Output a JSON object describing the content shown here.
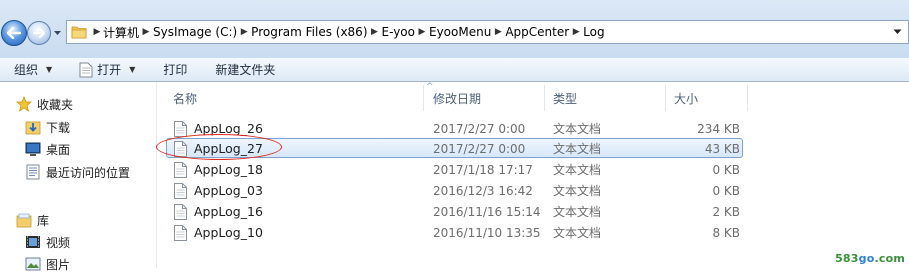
{
  "address_bar": {
    "breadcrumbs": [
      "计算机",
      "SysImage (C:)",
      "Program Files (x86)",
      "E-yoo",
      "EyooMenu",
      "AppCenter",
      "Log"
    ]
  },
  "toolbar": {
    "organize": "组织",
    "open": "打开",
    "print": "打印",
    "new_folder": "新建文件夹"
  },
  "navigation": {
    "favorites": {
      "label": "收藏夹",
      "items": [
        "下载",
        "桌面",
        "最近访问的位置"
      ]
    },
    "library": {
      "label": "库",
      "items": [
        "视频",
        "图片"
      ]
    }
  },
  "file_list": {
    "columns": {
      "name": "名称",
      "date_modified": "修改日期",
      "type": "类型",
      "size": "大小"
    },
    "files": [
      {
        "name": "AppLog_26",
        "date": "2017/2/27 0:00",
        "type": "文本文档",
        "size": "234 KB"
      },
      {
        "name": "AppLog_27",
        "date": "2017/2/27 0:00",
        "type": "文本文档",
        "size": "43 KB"
      },
      {
        "name": "AppLog_18",
        "date": "2017/1/18 17:17",
        "type": "文本文档",
        "size": "0 KB"
      },
      {
        "name": "AppLog_03",
        "date": "2016/12/3 16:42",
        "type": "文本文档",
        "size": "0 KB"
      },
      {
        "name": "AppLog_16",
        "date": "2016/11/16 15:14",
        "type": "文本文档",
        "size": "2 KB"
      },
      {
        "name": "AppLog_10",
        "date": "2016/11/10 13:35",
        "type": "文本文档",
        "size": "8 KB"
      }
    ],
    "selected_index": 1
  },
  "watermark": {
    "prefix": "583",
    "middle": "go",
    "suffix": ".com"
  },
  "colors": {
    "selection_border": "#7da2ce",
    "annotation_circle": "#e3261c",
    "toolbar_bg": "#dde9f5"
  }
}
